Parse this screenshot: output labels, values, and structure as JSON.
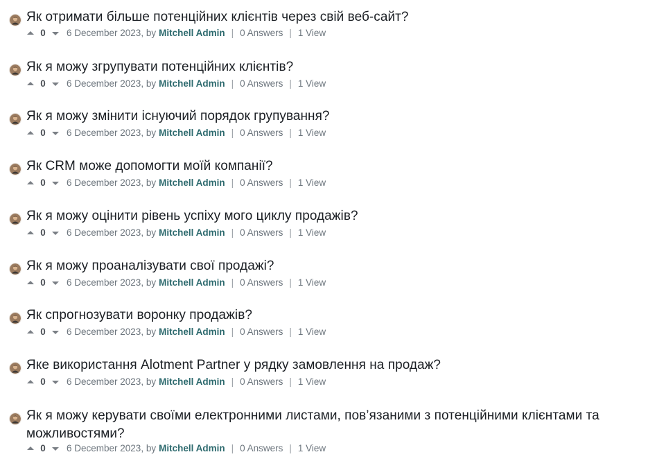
{
  "questions": [
    {
      "title": "Як отримати більше потенційних клієнтів через свій веб-сайт?",
      "score": "0",
      "date": "6 December 2023, by",
      "author": "Mitchell Admin",
      "answers": "0 Answers",
      "views": "1 View"
    },
    {
      "title": "Як я можу згрупувати потенційних клієнтів?",
      "score": "0",
      "date": "6 December 2023, by",
      "author": "Mitchell Admin",
      "answers": "0 Answers",
      "views": "1 View"
    },
    {
      "title": "Як я можу змінити існуючий порядок групування?",
      "score": "0",
      "date": "6 December 2023, by",
      "author": "Mitchell Admin",
      "answers": "0 Answers",
      "views": "1 View"
    },
    {
      "title": "Як CRM може допомогти моїй компанії?",
      "score": "0",
      "date": "6 December 2023, by",
      "author": "Mitchell Admin",
      "answers": "0 Answers",
      "views": "1 View"
    },
    {
      "title": "Як я можу оцінити рівень успіху мого циклу продажів?",
      "score": "0",
      "date": "6 December 2023, by",
      "author": "Mitchell Admin",
      "answers": "0 Answers",
      "views": "1 View"
    },
    {
      "title": "Як я можу проаналізувати свої продажі?",
      "score": "0",
      "date": "6 December 2023, by",
      "author": "Mitchell Admin",
      "answers": "0 Answers",
      "views": "1 View"
    },
    {
      "title": "Як спрогнозувати воронку продажів?",
      "score": "0",
      "date": "6 December 2023, by",
      "author": "Mitchell Admin",
      "answers": "0 Answers",
      "views": "1 View"
    },
    {
      "title": "Яке використання Alotment Partner у рядку замовлення на продаж?",
      "score": "0",
      "date": "6 December 2023, by",
      "author": "Mitchell Admin",
      "answers": "0 Answers",
      "views": "1 View"
    },
    {
      "title": "Як я можу керувати своїми електронними листами, пов’язаними з потенційними клієнтами та можливостями?",
      "score": "0",
      "date": "6 December 2023, by",
      "author": "Mitchell Admin",
      "answers": "0 Answers",
      "views": "1 View"
    }
  ]
}
